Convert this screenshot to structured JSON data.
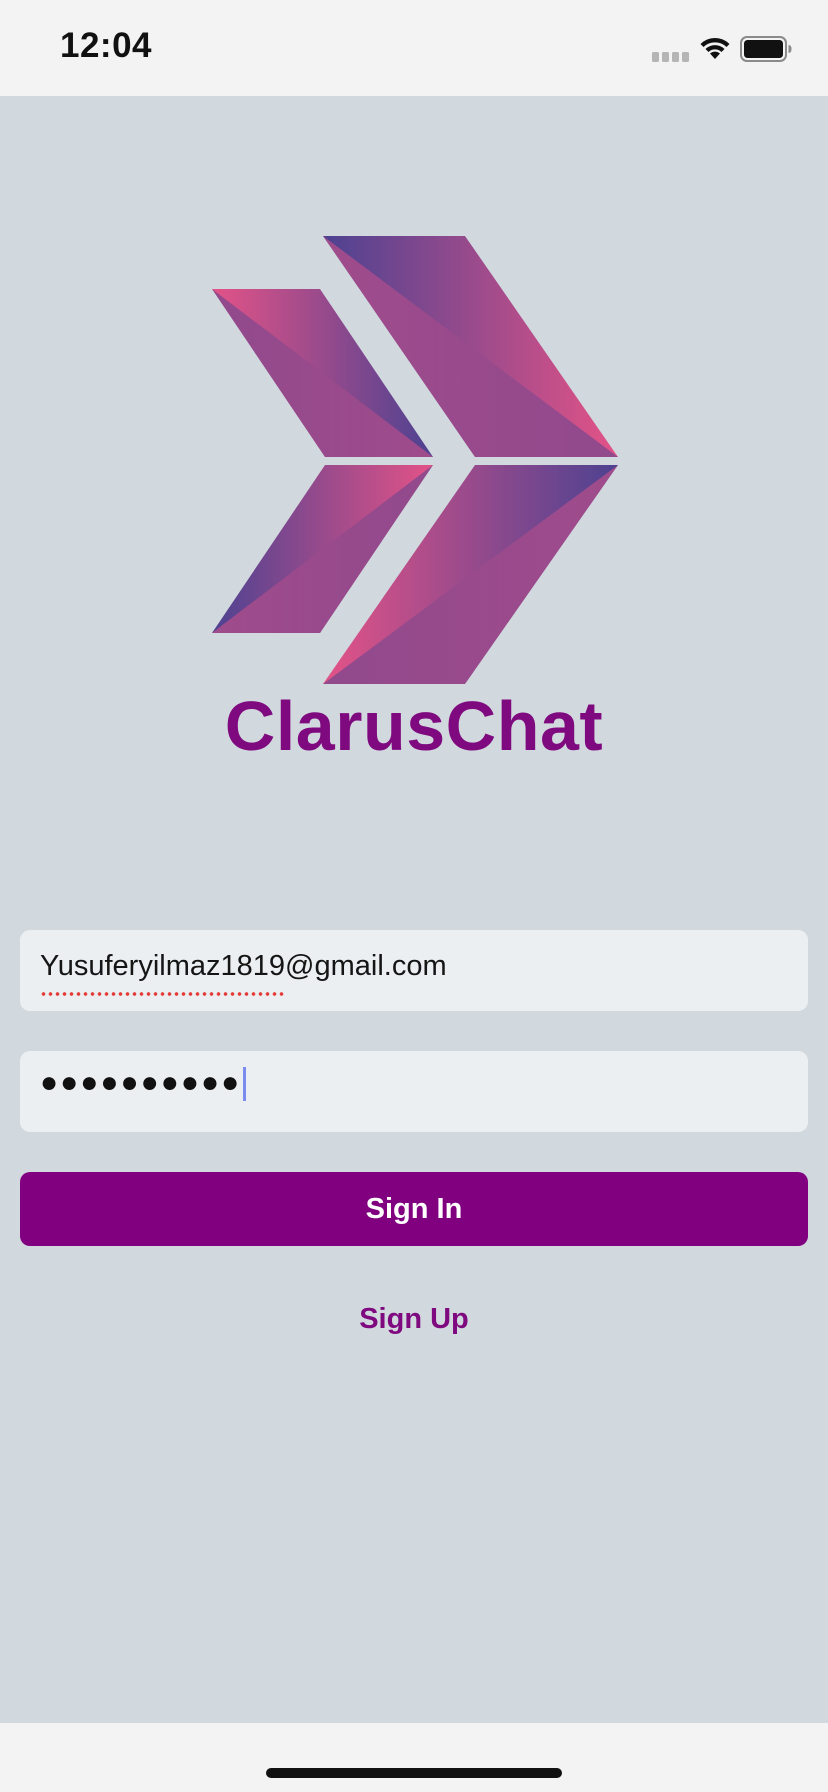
{
  "status_bar": {
    "time": "12:04"
  },
  "app": {
    "title": "ClarusChat",
    "logo_icon": "double-chevron-logo-icon",
    "brand_color": "#800080",
    "logo_gradient": [
      "#e35387",
      "#4d4291"
    ]
  },
  "login": {
    "email_value": "Yusuferyilmaz1819@gmail.com",
    "password_value": "●●●●●●●●●●",
    "signin_label": "Sign In",
    "signup_label": "Sign Up"
  },
  "colors": {
    "background": "#d1d8de",
    "field_background": "#ebeff1",
    "button_background": "#800080",
    "button_text": "#ffffff"
  }
}
